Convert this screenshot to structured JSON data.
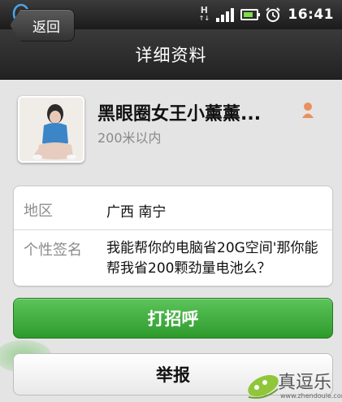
{
  "status_bar": {
    "network_type": "H",
    "time": "16:41",
    "signal_level": 4,
    "battery_level": 0.75
  },
  "title_bar": {
    "back_label": "返回",
    "title": "详细资料"
  },
  "profile": {
    "nickname": "黑眼圈女王小薰薰...",
    "distance": "200米以内"
  },
  "info": {
    "region_label": "地区",
    "region_value": "广西  南宁",
    "signature_label": "个性签名",
    "signature_value": "我能帮你的电脑省20G空间'那你能帮我省200颗劲量电池么？"
  },
  "actions": {
    "greet_label": "打招呼",
    "report_label": "举报"
  },
  "watermark": {
    "brand": "真逗乐",
    "url": "www.zhendoule.com"
  },
  "colors": {
    "greet_button": "#3fa83c",
    "title_bar": "#2a2a2a",
    "gender_female": "#e8905e"
  }
}
